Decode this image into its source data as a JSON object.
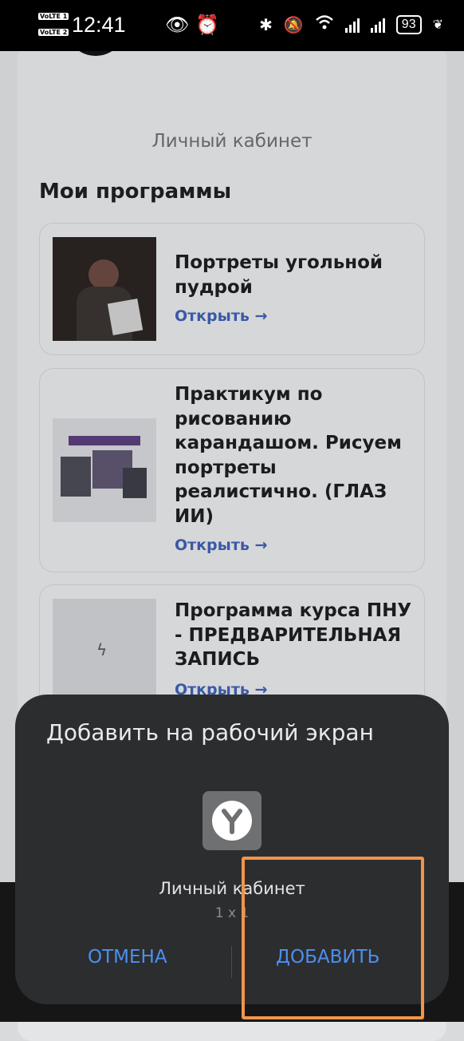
{
  "status_bar": {
    "sim1": "VoLTE 1",
    "sim2": "VoLTE 2",
    "time": "12:41",
    "battery": "93"
  },
  "page": {
    "subtitle": "Личный кабинет",
    "section_title": "Мои программы",
    "programs": [
      {
        "title": "Портреты угольной пудрой",
        "open": "Открыть →"
      },
      {
        "title": "Практикум по рисованию карандашом. Рисуем портреты реалистично. (ГЛАЗ ИИ)",
        "open": "Открыть →"
      },
      {
        "title": "Программа курса ПНУ - ПРЕДВАРИТЕЛЬНАЯ ЗАПИСЬ",
        "open": "Открыть →"
      }
    ]
  },
  "dialog": {
    "title": "Добавить на рабочий экран",
    "app_name": "Личный кабинет",
    "app_size": "1 x 1",
    "cancel_label": "ОТМЕНА",
    "add_label": "ДОБАВИТЬ"
  },
  "colors": {
    "accent": "#4c8ff0",
    "highlight": "#f0954a",
    "link": "#3e5fb0"
  }
}
